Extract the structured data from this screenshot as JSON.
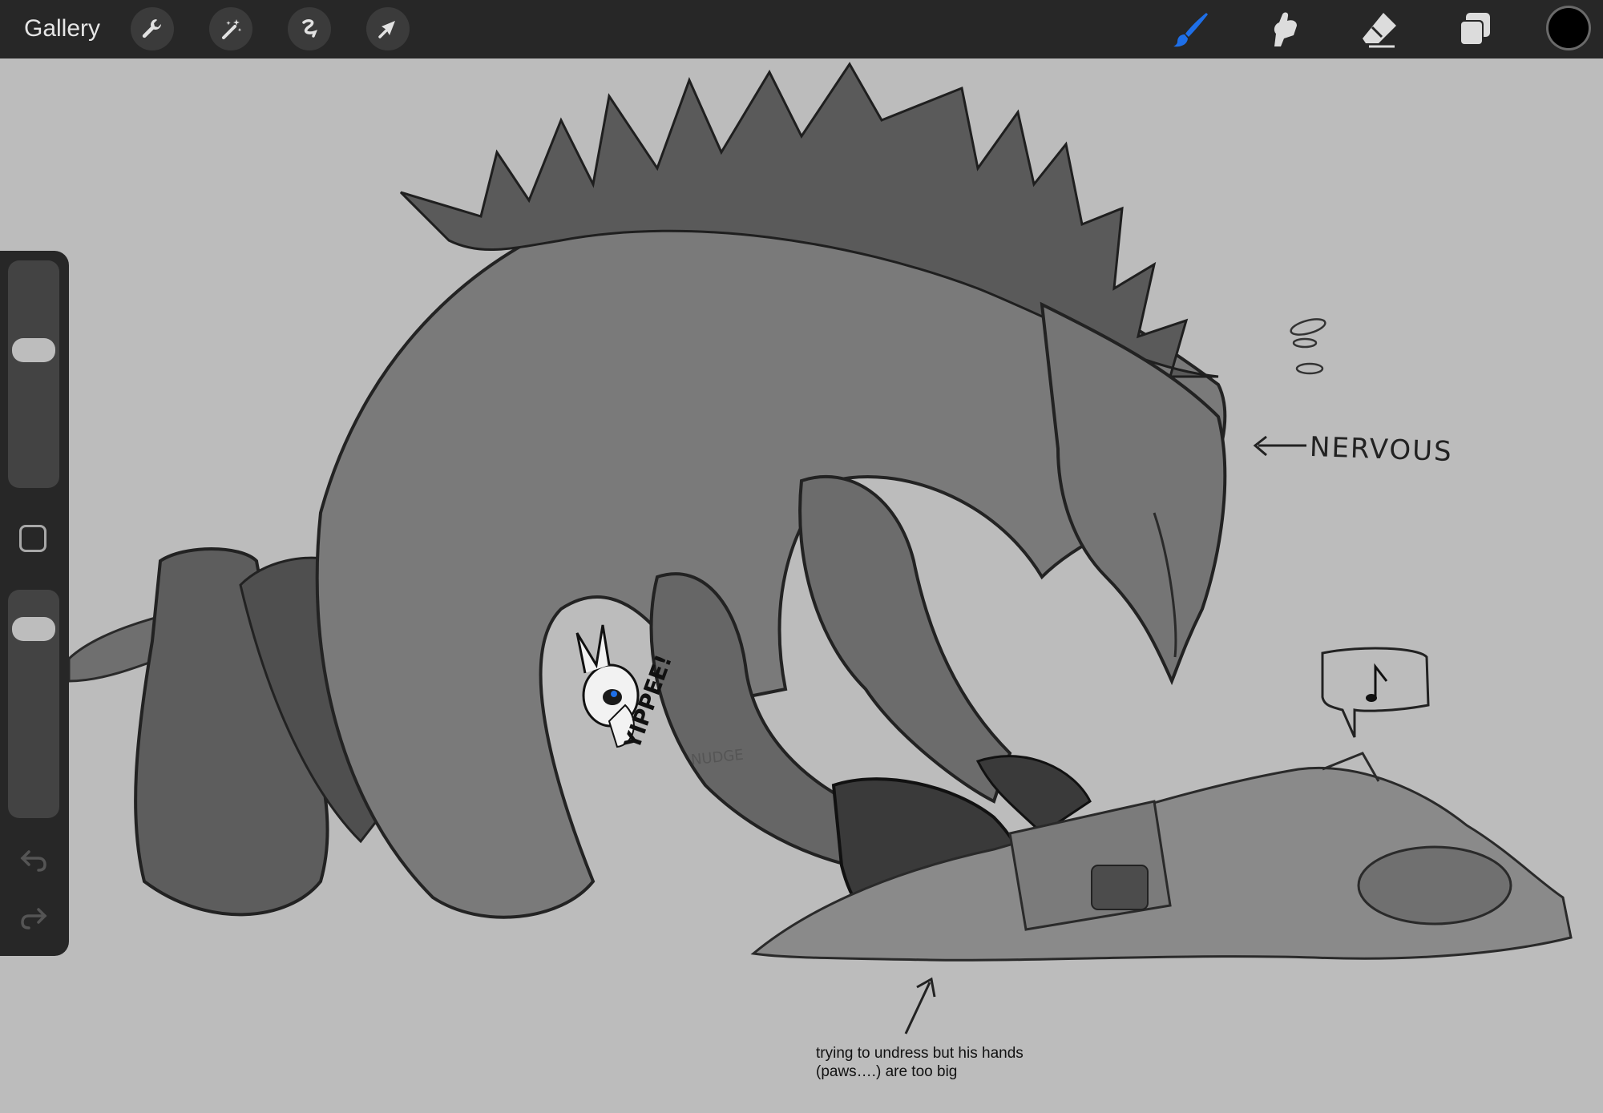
{
  "toolbar": {
    "gallery_label": "Gallery",
    "left_tools": [
      "wrench-icon",
      "magic-wand-icon",
      "selection-icon",
      "transform-arrow-icon"
    ],
    "right_tools": [
      "brush-icon",
      "smudge-icon",
      "eraser-icon",
      "layers-icon"
    ],
    "active_tool": "brush",
    "active_color": "#000000",
    "accent_color": "#1e6fe8"
  },
  "sidebar": {
    "brush_size_level": 0.62,
    "opacity_level": 0.88,
    "buttons": [
      "modify-square",
      "undo-icon",
      "redo-icon"
    ]
  },
  "canvas": {
    "background_color": "#bcbcbc",
    "annotations": {
      "nervous": "NERVOUS",
      "yippee": "YIPPEE!",
      "nudge": "NUDGE",
      "caption": "trying to undress but his hands (paws….) are too big"
    }
  }
}
